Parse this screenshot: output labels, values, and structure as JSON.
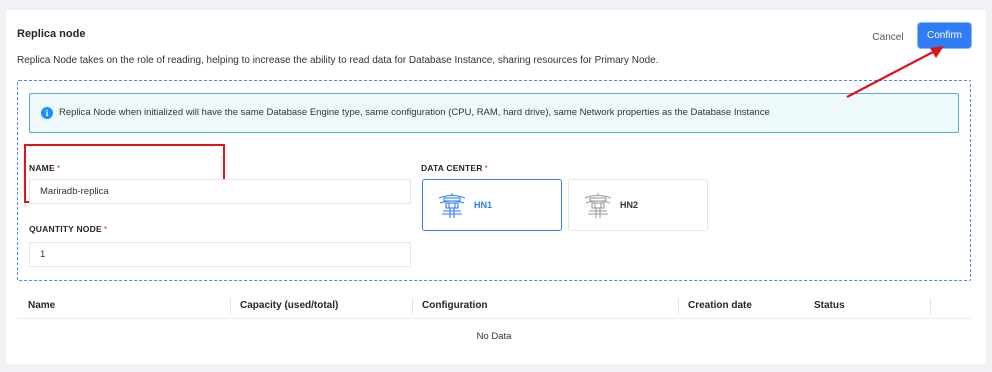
{
  "modal": {
    "title": "Replica node",
    "description": "Replica Node takes on the role of reading, helping to increase the ability to read data for Database Instance, sharing resources for Primary Node.",
    "cancel_label": "Cancel",
    "confirm_label": "Confirm"
  },
  "alert": {
    "icon": "info-icon",
    "text": "Replica Node when initialized will have the same Database Engine type, same configuration (CPU, RAM, hard drive), same Network properties as the Database Instance"
  },
  "form": {
    "name_label": "NAME",
    "name_value": "Mariradb-replica",
    "quantity_label": "QUANTITY NODE",
    "quantity_value": "1",
    "required_mark": "*",
    "datacenter_label": "DATA CENTER",
    "datacenters": [
      {
        "label": "HN1",
        "selected": true,
        "icon": "pagoda-icon"
      },
      {
        "label": "HN2",
        "selected": false,
        "icon": "pagoda-icon"
      }
    ]
  },
  "table": {
    "columns": [
      "Name",
      "Capacity (used/total)",
      "Configuration",
      "Creation date",
      "Status"
    ],
    "empty_text": "No Data"
  },
  "colors": {
    "primary": "#2f7cf6",
    "highlight": "#e0121a",
    "alert_border": "#4fb0c6",
    "alert_bg": "#eef9fb"
  }
}
